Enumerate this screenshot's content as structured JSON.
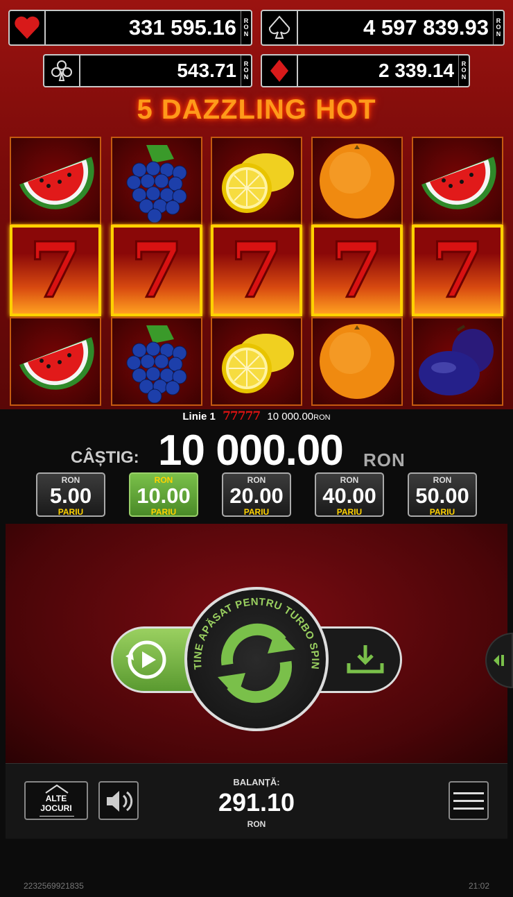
{
  "jackpots": {
    "hearts": {
      "value": "331 595.16",
      "currency": "RON"
    },
    "spades": {
      "value": "4 597 839.93",
      "currency": "RON"
    },
    "clubs": {
      "value": "543.71",
      "currency": "RON"
    },
    "diamonds": {
      "value": "2 339.14",
      "currency": "RON"
    }
  },
  "game_title": "5 DAZZLING HOT",
  "reels": [
    [
      "watermelon",
      "seven",
      "watermelon"
    ],
    [
      "grapes",
      "seven",
      "grapes"
    ],
    [
      "lemon",
      "seven",
      "lemon"
    ],
    [
      "orange",
      "seven",
      "orange"
    ],
    [
      "watermelon",
      "seven",
      "plum"
    ]
  ],
  "win_line": {
    "label": "Linie 1",
    "symbols": "77777",
    "amount": "10 000.00",
    "currency": "RON"
  },
  "win": {
    "label": "CÂȘTIG:",
    "amount": "10 000.00",
    "currency": "RON"
  },
  "bets": [
    {
      "currency": "RON",
      "value": "5.00",
      "label": "PARIU",
      "selected": false
    },
    {
      "currency": "RON",
      "value": "10.00",
      "label": "PARIU",
      "selected": true
    },
    {
      "currency": "RON",
      "value": "20.00",
      "label": "PARIU",
      "selected": false
    },
    {
      "currency": "RON",
      "value": "40.00",
      "label": "PARIU",
      "selected": false
    },
    {
      "currency": "RON",
      "value": "50.00",
      "label": "PARIU",
      "selected": false
    }
  ],
  "spin": {
    "curved_text": "TINE APĂSAT PENTRU TURBO SPIN"
  },
  "footer": {
    "other_games": "ALTE JOCURI",
    "balance_label": "BALANȚĂ:",
    "balance_value": "291.10",
    "balance_currency": "RON",
    "session_id": "2232569921835",
    "time": "21:02"
  },
  "colors": {
    "accent_green": "#7ac04a",
    "win_border": "#ffd200",
    "seven_red": "#d81212"
  }
}
